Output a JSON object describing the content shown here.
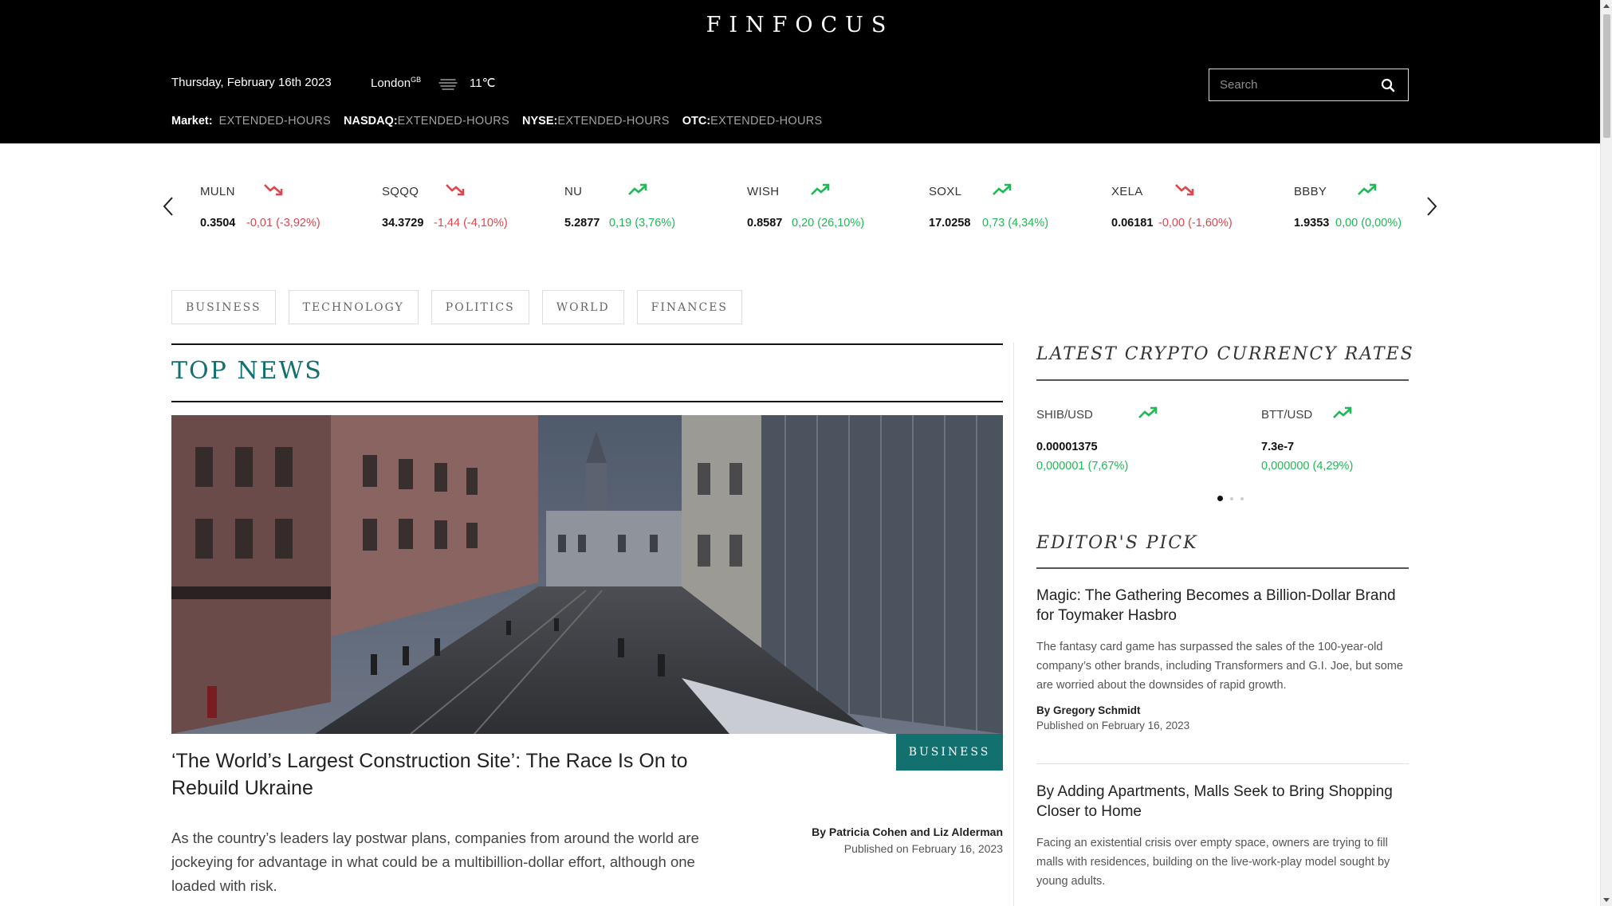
{
  "brand": {
    "logo": "FINFOCUS"
  },
  "header": {
    "date": "Thursday, February 16th 2023",
    "city": "London",
    "country": "GB",
    "temperature": "11℃",
    "weather_icon": "fog-icon",
    "search_placeholder": "Search"
  },
  "market": [
    {
      "label": "Market:",
      "status": "EXTENDED-HOURS"
    },
    {
      "label": "NASDAQ:",
      "status": "EXTENDED-HOURS"
    },
    {
      "label": "NYSE:",
      "status": "EXTENDED-HOURS"
    },
    {
      "label": "OTC:",
      "status": "EXTENDED-HOURS"
    }
  ],
  "ticker": [
    {
      "symbol": "MULN",
      "price": "0.3504",
      "change": "-0,01 (-3,92%)",
      "direction": "down"
    },
    {
      "symbol": "SQQQ",
      "price": "34.3729",
      "change": "-1,44 (-4,10%)",
      "direction": "down"
    },
    {
      "symbol": "NU",
      "price": "5.2877",
      "change": "0,19 (3,76%)",
      "direction": "up"
    },
    {
      "symbol": "WISH",
      "price": "0.8587",
      "change": "0,20 (26,10%)",
      "direction": "up"
    },
    {
      "symbol": "SOXL",
      "price": "17.0258",
      "change": "0,73 (4,34%)",
      "direction": "up"
    },
    {
      "symbol": "XELA",
      "price": "0.06181",
      "change": "-0,00 (-1,60%)",
      "direction": "down"
    },
    {
      "symbol": "BBBY",
      "price": "1.9353",
      "change": "0,00 (0,00%)",
      "direction": "up"
    }
  ],
  "categories": [
    "BUSINESS",
    "TECHNOLOGY",
    "POLITICS",
    "WORLD",
    "FINANCES"
  ],
  "top_news": {
    "section_title": "TOP NEWS",
    "badge": "BUSINESS",
    "headline": "‘The World’s Largest Construction Site’: The Race Is On to Rebuild Ukraine",
    "summary": "As the country’s leaders lay postwar plans, companies from around the world are jockeying for advantage in what could be a multibillion-dollar effort, although one loaded with risk.",
    "byline": "By Patricia Cohen and Liz Alderman",
    "published": "Published on February 16, 2023"
  },
  "crypto": {
    "title": "LATEST CRYPTO CURRENCY RATES",
    "items": [
      {
        "pair": "SHIB/USD",
        "price": "0.00001375",
        "change": "0,000001 (7,67%)",
        "direction": "up"
      },
      {
        "pair": "BTT/USD",
        "price": "7.3e-7",
        "change": "0,000000 (4,29%)",
        "direction": "up"
      }
    ],
    "pages": 3,
    "active_page": 1
  },
  "editors_pick": {
    "title": "EDITOR'S PICK",
    "items": [
      {
        "title": "Magic: The Gathering Becomes a Billion-Dollar Brand for Toymaker Hasbro",
        "description": "The fantasy card game has surpassed the sales of the 100-year-old company’s other brands, including Transformers and G.I. Joe, but some are worried about the downsides of rapid growth.",
        "byline": "By Gregory Schmidt",
        "published": "Published on February 16, 2023"
      },
      {
        "title": "By Adding Apartments, Malls Seek to Bring Shopping Closer to Home",
        "description": "Facing an existential crisis over empty space, owners are trying to fill malls with residences, building on the live-work-play model sought by young adults."
      }
    ]
  },
  "colors": {
    "accent": "#12706f",
    "up": "#1db954",
    "down": "#e0454c",
    "header_bg": "#000000"
  }
}
